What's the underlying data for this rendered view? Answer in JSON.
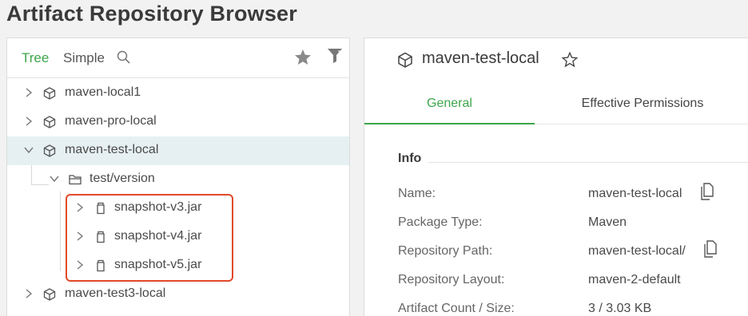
{
  "page": {
    "title": "Artifact Repository Browser"
  },
  "left_panel": {
    "tabs": {
      "tree": "Tree",
      "simple": "Simple"
    },
    "tree": [
      {
        "label": "maven-local1",
        "type": "repo",
        "expanded": false
      },
      {
        "label": "maven-pro-local",
        "type": "repo",
        "expanded": false
      },
      {
        "label": "maven-test-local",
        "type": "repo",
        "expanded": true,
        "selected": true
      },
      {
        "label": "test/version",
        "type": "folder",
        "expanded": true
      },
      {
        "label": "snapshot-v3.jar",
        "type": "jar",
        "expanded": false
      },
      {
        "label": "snapshot-v4.jar",
        "type": "jar",
        "expanded": false
      },
      {
        "label": "snapshot-v5.jar",
        "type": "jar",
        "expanded": false
      },
      {
        "label": "maven-test3-local",
        "type": "repo",
        "expanded": false
      }
    ]
  },
  "right_panel": {
    "repo_name": "maven-test-local",
    "tabs": {
      "general": "General",
      "effective_permissions": "Effective Permissions"
    },
    "info": {
      "title": "Info",
      "rows": [
        {
          "key": "Name:",
          "value": "maven-test-local",
          "copy": true
        },
        {
          "key": "Package Type:",
          "value": "Maven",
          "copy": false
        },
        {
          "key": "Repository Path:",
          "value": "maven-test-local/",
          "copy": true
        },
        {
          "key": "Repository Layout:",
          "value": "maven-2-default",
          "copy": false
        },
        {
          "key": "Artifact Count / Size:",
          "value": "3 / 3.03 KB",
          "copy": false
        }
      ]
    }
  },
  "colors": {
    "accent": "#3ca64a",
    "selection": "#e6f0f2",
    "highlight": "#e04a28"
  },
  "icons": {
    "search": "search-icon",
    "favorite": "star-icon",
    "filter": "filter-icon",
    "repo": "cube-icon",
    "folder": "folder-icon",
    "jar": "jar-icon",
    "expand": "chevron-right-icon",
    "collapse": "chevron-down-icon",
    "copy": "copy-icon"
  }
}
